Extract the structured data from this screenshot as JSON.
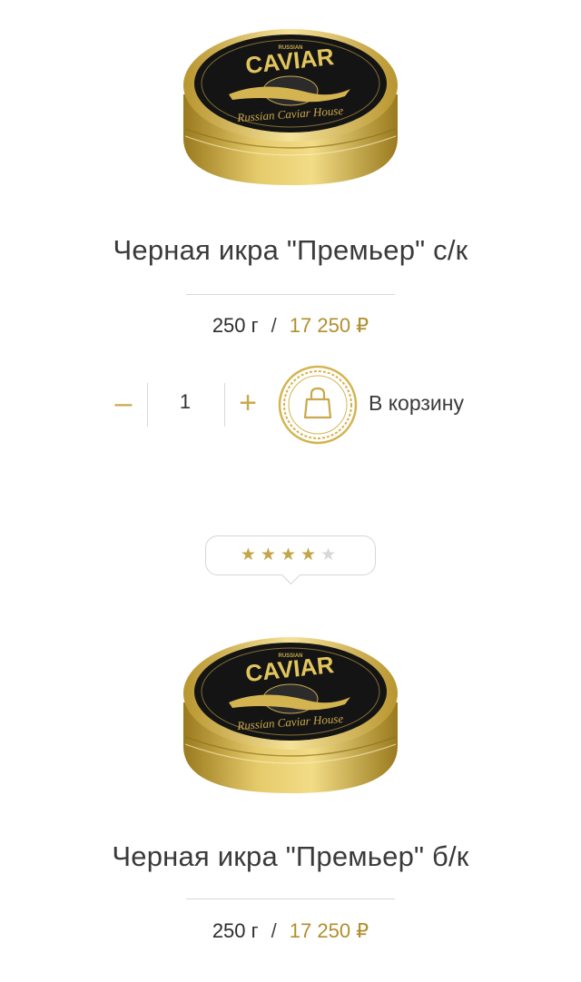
{
  "products": [
    {
      "title": "Черная икра \"Премьер\" с/к",
      "weight": "250 г",
      "separator": "/",
      "price": "17 250 ₽",
      "quantity": "1",
      "minus_label": "–",
      "plus_label": "+",
      "cart_label": "В корзину",
      "tin_text": {
        "brand": "CAVIAR",
        "top": "RUSSIAN",
        "script": "Russian Caviar House"
      }
    },
    {
      "title": "Черная икра \"Премьер\" б/к",
      "weight": "250 г",
      "separator": "/",
      "price": "17 250 ₽",
      "rating": {
        "value": 4,
        "max": 5
      },
      "tin_text": {
        "brand": "CAVIAR",
        "top": "RUSSIAN",
        "script": "Russian Caviar House"
      }
    }
  ],
  "colors": {
    "accent": "#b08f2e",
    "gold_light": "#e2c768",
    "gold_dark": "#9a7a1e",
    "lid": "#141414"
  },
  "icons": {
    "cart": "shopping-bag-icon",
    "star": "star-icon"
  }
}
